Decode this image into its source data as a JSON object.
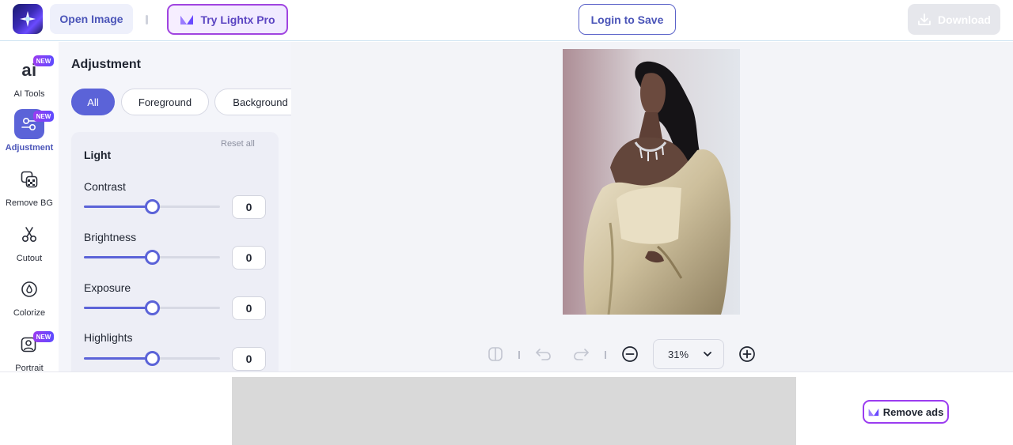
{
  "header": {
    "open_image_label": "Open Image",
    "pro_label": "Try Lightx Pro",
    "login_label": "Login to Save",
    "download_label": "Download"
  },
  "rail": {
    "items": [
      {
        "label": "AI Tools",
        "new": "NEW"
      },
      {
        "label": "Adjustment",
        "new": "NEW"
      },
      {
        "label": "Remove BG"
      },
      {
        "label": "Cutout"
      },
      {
        "label": "Colorize"
      },
      {
        "label": "Portrait",
        "new": "NEW"
      }
    ],
    "ai_glyph": "ai"
  },
  "panel": {
    "title": "Adjustment",
    "chips": [
      "All",
      "Foreground",
      "Background"
    ],
    "active_chip": "All",
    "section_title": "Light",
    "reset_label": "Reset all",
    "sliders": [
      {
        "label": "Contrast",
        "value": "0",
        "level": 0.5
      },
      {
        "label": "Brightness",
        "value": "0",
        "level": 0.5
      },
      {
        "label": "Exposure",
        "value": "0",
        "level": 0.5
      },
      {
        "label": "Highlights",
        "value": "0",
        "level": 0.5
      }
    ]
  },
  "canvas": {
    "zoom_value": "31%"
  },
  "footer": {
    "remove_ads_label": "Remove ads"
  },
  "colors": {
    "accent": "#5b63d8",
    "pro_border": "#a044e0",
    "new_badge": "#9b3cf0"
  }
}
